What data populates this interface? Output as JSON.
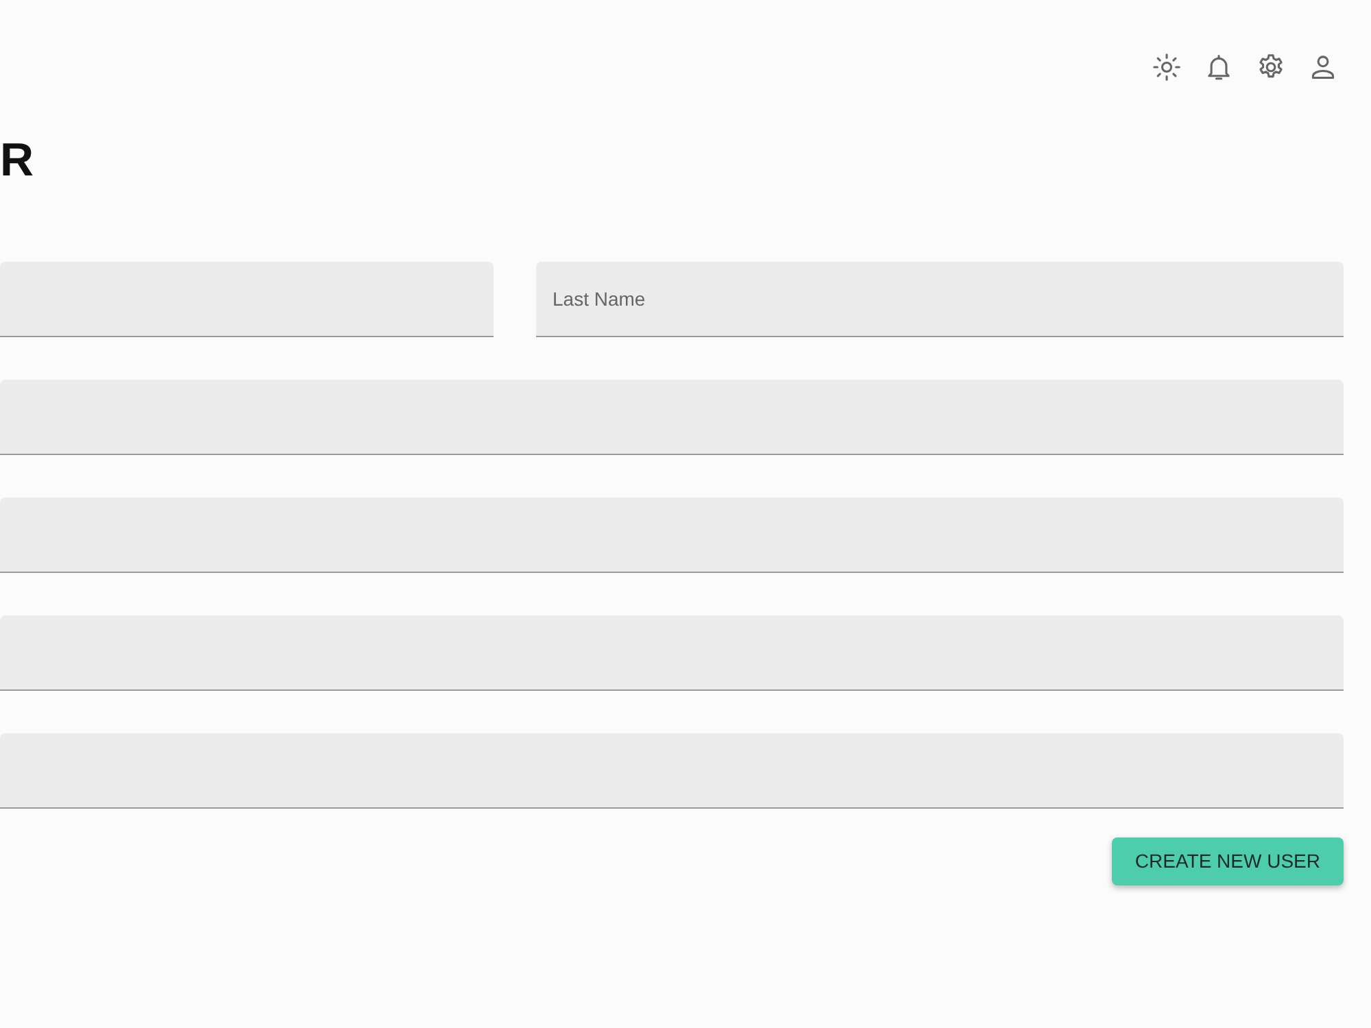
{
  "page": {
    "title": "R"
  },
  "form": {
    "rows": [
      {
        "fields": [
          {
            "kind": "text"
          },
          {
            "kind": "text",
            "placeholder": "Last Name"
          }
        ]
      },
      {
        "fields": [
          {
            "kind": "text"
          }
        ]
      },
      {
        "fields": [
          {
            "kind": "text"
          }
        ]
      },
      {
        "fields": [
          {
            "kind": "text"
          }
        ]
      },
      {
        "fields": [
          {
            "kind": "text"
          }
        ]
      }
    ]
  },
  "actions": {
    "buttons": [
      {
        "label": "CREATE NEW USER"
      }
    ]
  }
}
